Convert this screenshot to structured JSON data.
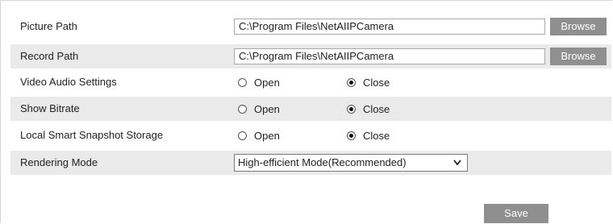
{
  "picture_path": {
    "label": "Picture Path",
    "value": "C:\\Program Files\\NetAIIPCamera",
    "button": "Browse"
  },
  "record_path": {
    "label": "Record Path",
    "value": "C:\\Program Files\\NetAIIPCamera",
    "button": "Browse"
  },
  "video_audio": {
    "label": "Video Audio Settings",
    "open": "Open",
    "close": "Close",
    "selected": "close"
  },
  "show_bitrate": {
    "label": "Show Bitrate",
    "open": "Open",
    "close": "Close",
    "selected": "close"
  },
  "snapshot_storage": {
    "label": "Local Smart Snapshot Storage",
    "open": "Open",
    "close": "Close",
    "selected": "close"
  },
  "rendering_mode": {
    "label": "Rendering Mode",
    "selected": "High-efficient Mode(Recommended)"
  },
  "save_label": "Save",
  "colors": {
    "button_bg": "#8f8f8f",
    "shade_row": "#eaeaea"
  }
}
